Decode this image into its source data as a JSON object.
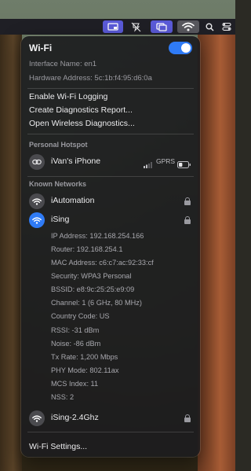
{
  "colors": {
    "accent": "#2f7bf6",
    "menu_bar": "#1f1f25",
    "panel": "#1c1c1e"
  },
  "menubar": {
    "icons": [
      "screen-mirroring-icon",
      "airplay-off-icon",
      "display-icon",
      "wifi-icon",
      "search-icon",
      "control-center-icon"
    ]
  },
  "header": {
    "title": "Wi-Fi",
    "toggle_on": true
  },
  "interface": {
    "name": "Interface Name: en1",
    "hardware": "Hardware Address: 5c:1b:f4:95:d6:0a"
  },
  "actions": {
    "logging": "Enable Wi-Fi Logging",
    "diagnostics_report": "Create Diagnostics Report...",
    "wireless_diagnostics": "Open Wireless Diagnostics..."
  },
  "hotspot": {
    "section": "Personal Hotspot",
    "device": "iVan's iPhone",
    "network_type": "GPRS",
    "signal_bars": 2,
    "battery_level": 0.4
  },
  "known": {
    "section": "Known Networks",
    "networks": [
      {
        "name": "iAutomation",
        "locked": true
      },
      {
        "name": "iSing",
        "locked": true,
        "connected": true
      },
      {
        "name": "iSing-2.4Ghz",
        "locked": true
      }
    ],
    "details": [
      "IP Address: 192.168.254.166",
      "Router: 192.168.254.1",
      "MAC Address: c6:c7:ac:92:33:cf",
      "Security: WPA3 Personal",
      "BSSID: e8:9c:25:25:e9:09",
      "Channel: 1 (6 GHz, 80 MHz)",
      "Country Code: US",
      "RSSI: -31 dBm",
      "Noise: -86 dBm",
      "Tx Rate: 1,200 Mbps",
      "PHY Mode: 802.11ax",
      "MCS Index: 11",
      "NSS: 2"
    ]
  },
  "footer": {
    "settings": "Wi-Fi Settings..."
  }
}
